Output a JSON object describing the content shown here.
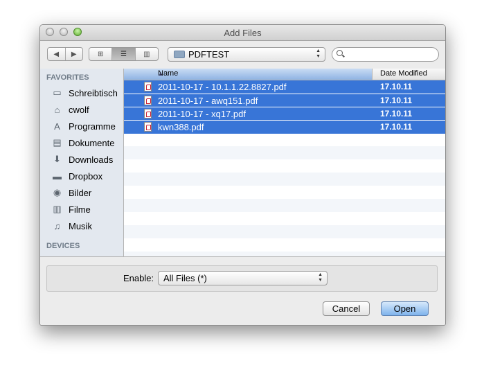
{
  "window": {
    "title": "Add Files"
  },
  "toolbar": {
    "back_glyph": "◀",
    "forward_glyph": "▶",
    "view_icon_glyph": "⊞",
    "view_list_glyph": "☰",
    "view_columns_glyph": "▥",
    "location": "PDFTEST",
    "search_value": "",
    "search_placeholder": ""
  },
  "sidebar": {
    "favorites_label": "FAVORITES",
    "devices_label": "DEVICES",
    "items": [
      {
        "label": "Schreibtisch",
        "icon": "desktop-icon",
        "glyph": "▭"
      },
      {
        "label": "cwolf",
        "icon": "home-icon",
        "glyph": "⌂"
      },
      {
        "label": "Programme",
        "icon": "applications-icon",
        "glyph": "A"
      },
      {
        "label": "Dokumente",
        "icon": "documents-icon",
        "glyph": "▤"
      },
      {
        "label": "Downloads",
        "icon": "downloads-icon",
        "glyph": "⬇"
      },
      {
        "label": "Dropbox",
        "icon": "folder-icon",
        "glyph": "▬"
      },
      {
        "label": "Bilder",
        "icon": "camera-icon",
        "glyph": "◉"
      },
      {
        "label": "Filme",
        "icon": "film-icon",
        "glyph": "▥"
      },
      {
        "label": "Musik",
        "icon": "music-icon",
        "glyph": "♫"
      }
    ]
  },
  "filelist": {
    "columns": {
      "name": "Name",
      "date": "Date Modified",
      "sort_glyph": "▲"
    },
    "rows": [
      {
        "name": "2011-10-17 - 10.1.1.22.8827.pdf",
        "date": "17.10.11",
        "selected": true
      },
      {
        "name": "2011-10-17 - awq151.pdf",
        "date": "17.10.11",
        "selected": true
      },
      {
        "name": "2011-10-17 - xq17.pdf",
        "date": "17.10.11",
        "selected": true
      },
      {
        "name": "kwn388.pdf",
        "date": "17.10.11",
        "selected": true
      }
    ]
  },
  "options": {
    "enable_label": "Enable:",
    "enable_value": "All Files (*)"
  },
  "buttons": {
    "cancel": "Cancel",
    "open": "Open"
  },
  "colors": {
    "selection": "#3875d7",
    "sidebar_bg": "#e3e8ef",
    "default_button": "#7eb3ec"
  }
}
